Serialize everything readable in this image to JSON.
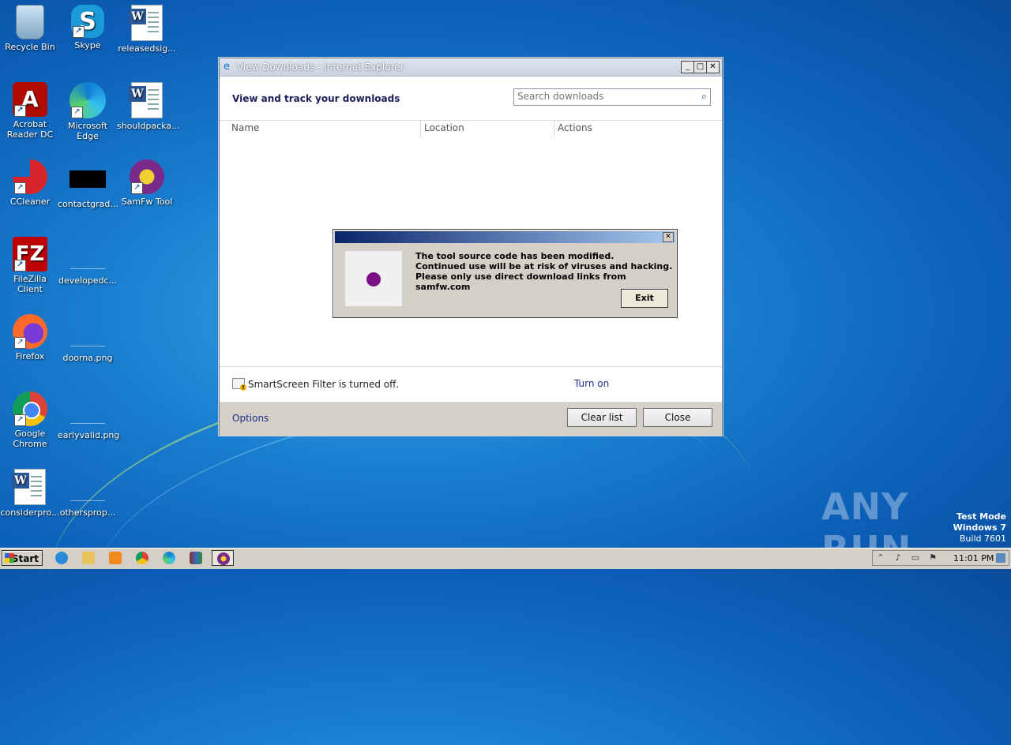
{
  "desktop": {
    "icons": [
      {
        "label": "Recycle Bin"
      },
      {
        "label": "Skype"
      },
      {
        "label": "releasedsig..."
      },
      {
        "label": "Acrobat Reader DC"
      },
      {
        "label": "Microsoft Edge"
      },
      {
        "label": "shouldpacka..."
      },
      {
        "label": "CCleaner"
      },
      {
        "label": "contactgrad..."
      },
      {
        "label": "SamFw Tool"
      },
      {
        "label": "FileZilla Client"
      },
      {
        "label": "developedc..."
      },
      {
        "label": "Firefox"
      },
      {
        "label": "doorna.png"
      },
      {
        "label": "Google Chrome"
      },
      {
        "label": "earlyvalid.png"
      },
      {
        "label": "considerpro..."
      },
      {
        "label": "othersprop..."
      }
    ]
  },
  "ie_window": {
    "title": "View Downloads - Internet Explorer",
    "heading": "View and track your downloads",
    "search_placeholder": "Search downloads",
    "columns": [
      "Name",
      "Location",
      "Actions"
    ],
    "smartscreen_text": "SmartScreen Filter is turned off.",
    "turn_on": "Turn on",
    "options": "Options",
    "clear_list": "Clear list",
    "close": "Close"
  },
  "alert": {
    "line1": "The tool source code has been modified.",
    "line2": "Continued use will be at risk of viruses and hacking.",
    "line3": "Please only use direct download links from samfw.com",
    "exit": "Exit",
    "accent": "#7a0f86"
  },
  "watermark": "ANY RUN",
  "system": {
    "test_mode": "Test Mode",
    "os": "Windows 7",
    "build": "Build 7601",
    "start": "Start",
    "clock": "11:01 PM"
  }
}
